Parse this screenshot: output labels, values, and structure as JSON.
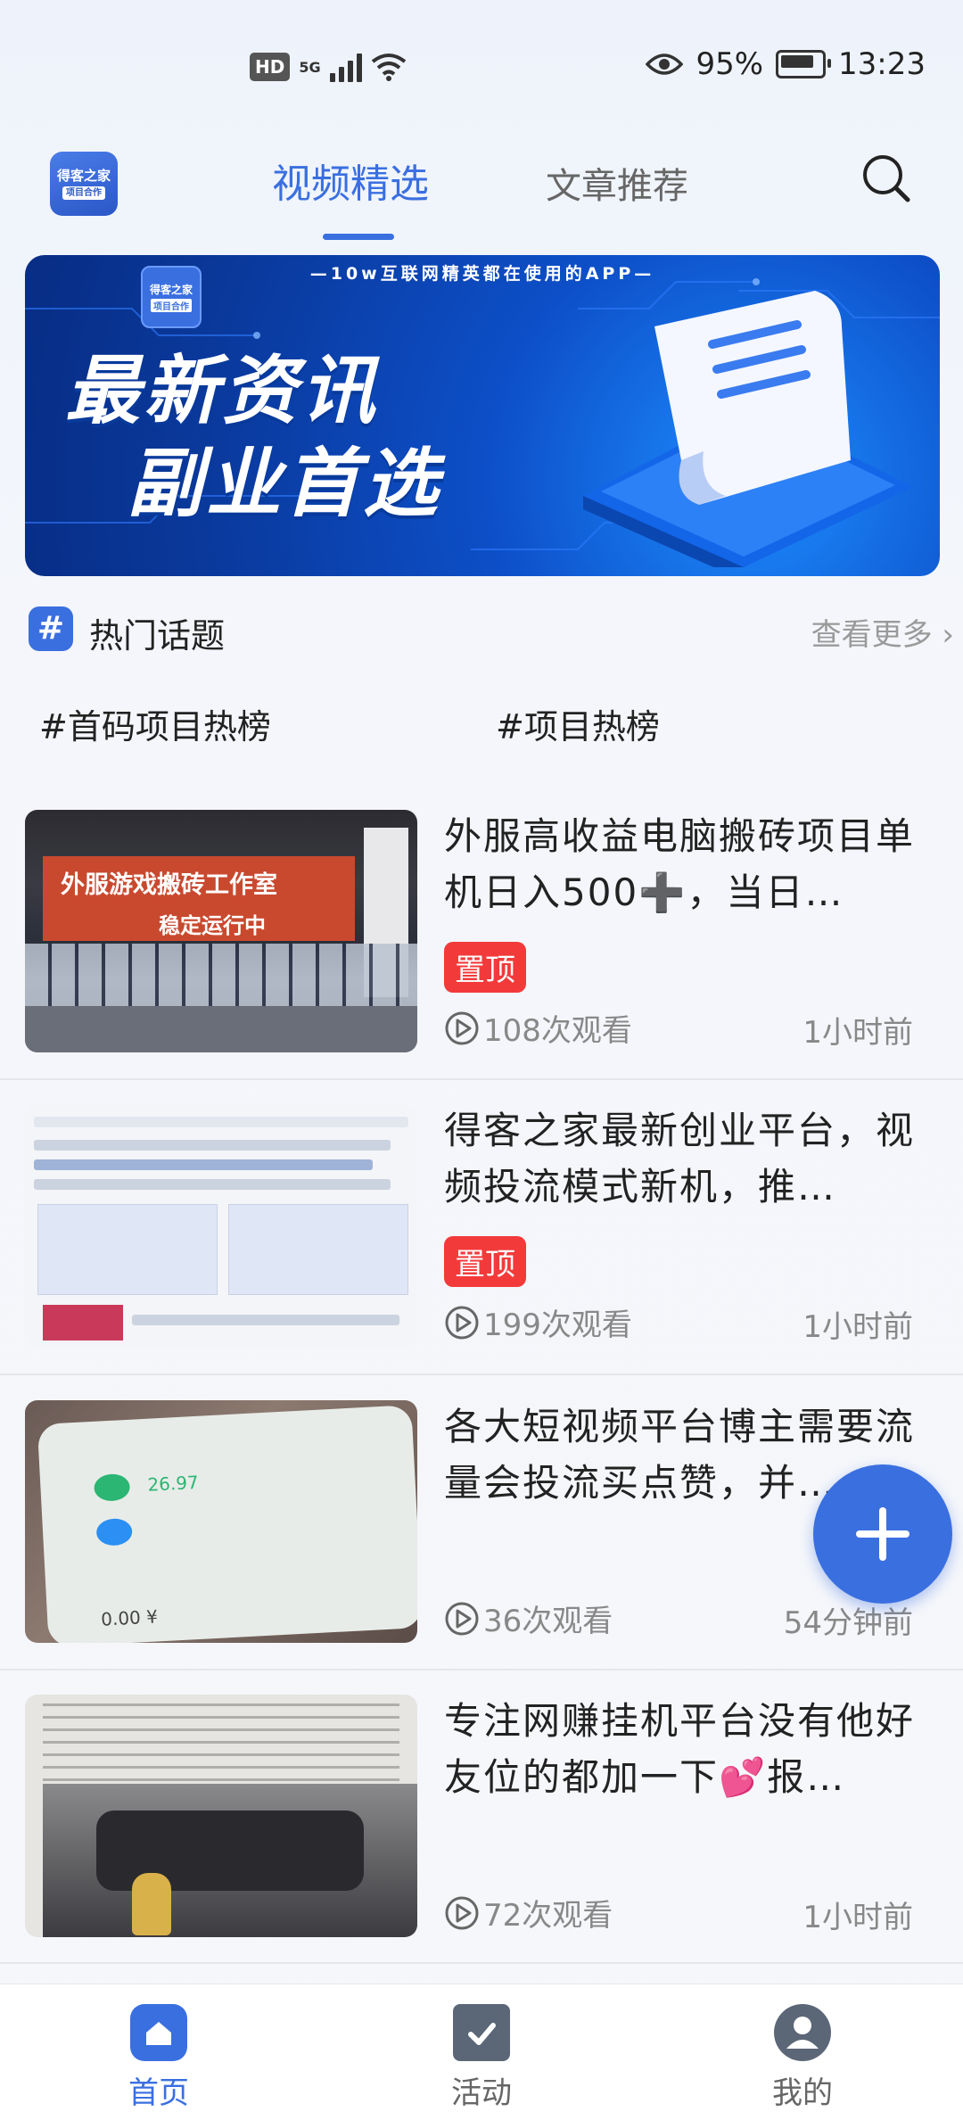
{
  "status_bar": {
    "network_badge": "HD",
    "network_type": "5G",
    "battery_percent": "95%",
    "time": "13:23"
  },
  "header": {
    "logo_text": "得客之家",
    "logo_sub": "项目合作",
    "tabs": [
      {
        "label": "视频精选",
        "active": true
      },
      {
        "label": "文章推荐",
        "active": false
      }
    ]
  },
  "banner": {
    "top_text": "—10w互联网精英都在使用的APP—",
    "logo_text": "得客之家",
    "logo_sub": "项目合作",
    "line1": "最新资讯",
    "line2": "副业首选"
  },
  "hot_topics": {
    "icon": "#",
    "title": "热门话题",
    "more_label": "查看更多 ›",
    "topics": [
      "#首码项目热榜",
      "#项目热榜"
    ]
  },
  "feed": [
    {
      "title": "外服高收益电脑搬砖项目单机日入500➕，当日…",
      "pinned": true,
      "pin_label": "置顶",
      "views": "108次观看",
      "time": "1小时前",
      "thumb_text1": "外服游戏搬砖工作室",
      "thumb_text2": "稳定运行中"
    },
    {
      "title": "得客之家最新创业平台，视频投流模式新机，推…",
      "pinned": true,
      "pin_label": "置顶",
      "views": "199次观看",
      "time": "1小时前"
    },
    {
      "title": "各大短视频平台博主需要流量会投流买点赞，并…",
      "pinned": false,
      "views": "36次观看",
      "time": "54分钟前",
      "thumb_text1": "26.97",
      "thumb_text2": "0.00 ¥"
    },
    {
      "title": "专注网赚挂机平台没有他好友位的都加一下💕报…",
      "pinned": false,
      "views": "72次观看",
      "time": "1小时前"
    }
  ],
  "bottom_nav": [
    {
      "label": "首页",
      "icon": "home-icon",
      "active": true
    },
    {
      "label": "活动",
      "icon": "task-icon",
      "active": false
    },
    {
      "label": "我的",
      "icon": "profile-icon",
      "active": false
    }
  ],
  "colors": {
    "accent": "#3a6fe0",
    "pin": "#f23a3a"
  }
}
